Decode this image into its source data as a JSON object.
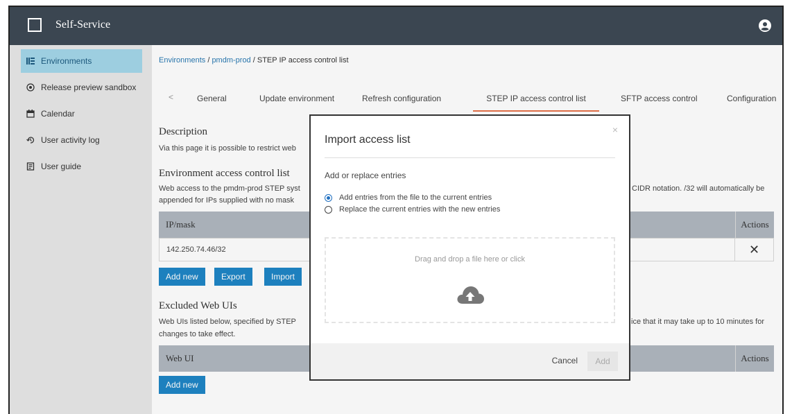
{
  "app": {
    "title": "Self-Service",
    "logo_icon": "square-outline-icon",
    "user_icon": "user-circle-icon"
  },
  "sidebar": {
    "items": [
      {
        "label": "Environments",
        "icon": "hierarchy-icon",
        "active": true
      },
      {
        "label": "Release preview sandbox",
        "icon": "preview-icon",
        "active": false
      },
      {
        "label": "Calendar",
        "icon": "calendar-icon",
        "active": false
      },
      {
        "label": "User activity log",
        "icon": "history-icon",
        "active": false
      },
      {
        "label": "User guide",
        "icon": "book-icon",
        "active": false
      }
    ]
  },
  "breadcrumb": {
    "root": "Environments",
    "sep1": " / ",
    "env": "pmdm-prod",
    "sep2": " / ",
    "current": "STEP IP access control list"
  },
  "tabs": {
    "back": "<",
    "items": [
      "General",
      "Update environment",
      "Refresh configuration",
      "STEP IP access control list",
      "SFTP access control",
      "Configuration"
    ],
    "active": "STEP IP access control list"
  },
  "description": {
    "title": "Description",
    "text": "Via this page it is possible to restrict web"
  },
  "env_acl": {
    "title": "Environment access control list",
    "text_line1": "Web access to the pmdm-prod STEP syst",
    "text_line1_right": "CIDR notation. /32 will automatically be",
    "text_line2": "appended for IPs supplied with no mask",
    "col_ip": "IP/mask",
    "col_actions": "Actions",
    "rows": [
      {
        "ip": "142.250.74.46/32",
        "action": "✕"
      }
    ],
    "buttons": {
      "add": "Add new",
      "export": "Export",
      "import": "Import"
    }
  },
  "excluded": {
    "title": "Excluded Web UIs",
    "text_line1": "Web UIs listed below, specified by STEP",
    "text_line1_right": "ice that it may take up to 10 minutes for",
    "text_line2": "changes to take effect.",
    "col_webui": "Web UI",
    "col_actions": "Actions",
    "buttons": {
      "add": "Add new"
    }
  },
  "modal": {
    "title": "Import access list",
    "close": "×",
    "subtitle": "Add or replace entries",
    "options": [
      {
        "label": "Add entries from the file to the current entries",
        "checked": true
      },
      {
        "label": "Replace the current entries with the new entries",
        "checked": false
      }
    ],
    "dropzone_text": "Drag and drop a file here or click",
    "dropzone_icon": "cloud-upload-icon",
    "cancel": "Cancel",
    "add": "Add"
  },
  "colors": {
    "topbar": "#3b4651",
    "accent": "#1f86c6",
    "active_tab": "#e8734a",
    "sidebar_active": "#a4d7ea"
  }
}
